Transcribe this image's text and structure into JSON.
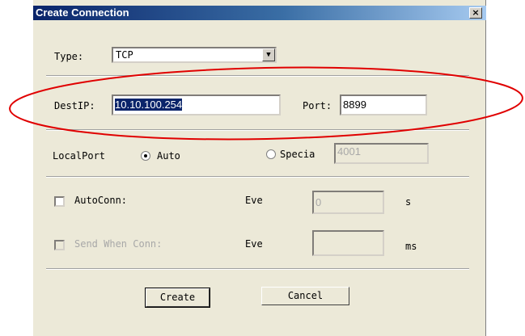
{
  "window": {
    "title": "Create Connection",
    "close_symbol": "×"
  },
  "type_row": {
    "label": "Type:",
    "value": "TCP"
  },
  "dest_row": {
    "ip_label": "DestIP:",
    "ip_value": "10.10.100.254",
    "port_label": "Port:",
    "port_value": "8899"
  },
  "local_row": {
    "label": "LocalPort",
    "auto_label": "Auto",
    "special_label": "Specia",
    "special_value": "4001",
    "selected": "Auto"
  },
  "autoconn_row": {
    "label": "AutoConn:",
    "every_label": "Eve",
    "value": "0",
    "unit": "s",
    "checked": false
  },
  "send_row": {
    "label": "Send When Conn:",
    "every_label": "Eve",
    "value": "",
    "unit": "ms",
    "checked": false,
    "enabled": false
  },
  "buttons": {
    "create": "Create",
    "cancel": "Cancel"
  },
  "colors": {
    "annotation": "#e00000",
    "title_bar": "#0a246a"
  }
}
